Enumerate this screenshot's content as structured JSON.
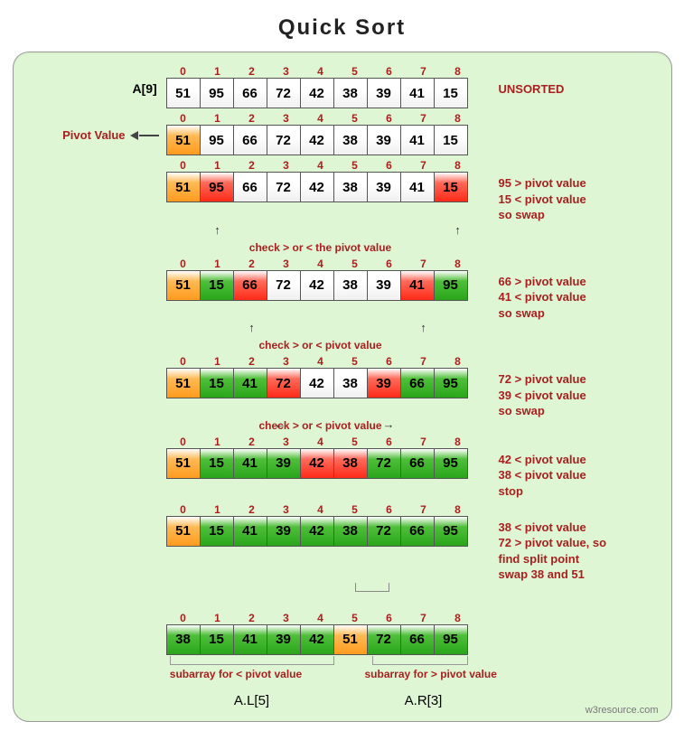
{
  "title": "Quick   Sort",
  "array_label": "A[9]",
  "pivot_label": "Pivot Value",
  "indices": [
    "0",
    "1",
    "2",
    "3",
    "4",
    "5",
    "6",
    "7",
    "8"
  ],
  "stages": [
    {
      "cells": [
        {
          "v": "51",
          "c": "white"
        },
        {
          "v": "95",
          "c": "white"
        },
        {
          "v": "66",
          "c": "white"
        },
        {
          "v": "72",
          "c": "white"
        },
        {
          "v": "42",
          "c": "white"
        },
        {
          "v": "38",
          "c": "white"
        },
        {
          "v": "39",
          "c": "white"
        },
        {
          "v": "41",
          "c": "white"
        },
        {
          "v": "15",
          "c": "white"
        }
      ],
      "right_note": "UNSORTED",
      "show_array_label": true
    },
    {
      "cells": [
        {
          "v": "51",
          "c": "orange"
        },
        {
          "v": "95",
          "c": "white"
        },
        {
          "v": "66",
          "c": "white"
        },
        {
          "v": "72",
          "c": "white"
        },
        {
          "v": "42",
          "c": "white"
        },
        {
          "v": "38",
          "c": "white"
        },
        {
          "v": "39",
          "c": "white"
        },
        {
          "v": "41",
          "c": "white"
        },
        {
          "v": "15",
          "c": "white"
        }
      ],
      "left_note": "pivot"
    },
    {
      "cells": [
        {
          "v": "51",
          "c": "orange"
        },
        {
          "v": "95",
          "c": "red"
        },
        {
          "v": "66",
          "c": "white"
        },
        {
          "v": "72",
          "c": "white"
        },
        {
          "v": "42",
          "c": "white"
        },
        {
          "v": "38",
          "c": "white"
        },
        {
          "v": "39",
          "c": "white"
        },
        {
          "v": "41",
          "c": "white"
        },
        {
          "v": "15",
          "c": "red"
        }
      ],
      "right_note": "95 > pivot value\n15 < pivot value\nso  swap",
      "under_note": "check > or < the pivot value",
      "up_arrows_at": [
        1,
        8
      ]
    },
    {
      "cells": [
        {
          "v": "51",
          "c": "orange"
        },
        {
          "v": "15",
          "c": "green"
        },
        {
          "v": "66",
          "c": "red"
        },
        {
          "v": "72",
          "c": "white"
        },
        {
          "v": "42",
          "c": "white"
        },
        {
          "v": "38",
          "c": "white"
        },
        {
          "v": "39",
          "c": "white"
        },
        {
          "v": "41",
          "c": "red"
        },
        {
          "v": "95",
          "c": "green"
        }
      ],
      "right_note": "66 > pivot value\n41 < pivot value\nso  swap",
      "under_note": "check > or < pivot value",
      "up_arrows_at": [
        2,
        7
      ]
    },
    {
      "cells": [
        {
          "v": "51",
          "c": "orange"
        },
        {
          "v": "15",
          "c": "green"
        },
        {
          "v": "41",
          "c": "green"
        },
        {
          "v": "72",
          "c": "red"
        },
        {
          "v": "42",
          "c": "white"
        },
        {
          "v": "38",
          "c": "white"
        },
        {
          "v": "39",
          "c": "red"
        },
        {
          "v": "66",
          "c": "green"
        },
        {
          "v": "95",
          "c": "green"
        }
      ],
      "right_note": "72 > pivot value\n39 < pivot value\nso  swap",
      "under_note": "check  >  or  <     pivot value",
      "lr_arrows_at": [
        3,
        6
      ]
    },
    {
      "cells": [
        {
          "v": "51",
          "c": "orange"
        },
        {
          "v": "15",
          "c": "green"
        },
        {
          "v": "41",
          "c": "green"
        },
        {
          "v": "39",
          "c": "green"
        },
        {
          "v": "42",
          "c": "red"
        },
        {
          "v": "38",
          "c": "red"
        },
        {
          "v": "72",
          "c": "green"
        },
        {
          "v": "66",
          "c": "green"
        },
        {
          "v": "95",
          "c": "green"
        }
      ],
      "right_note": "42 < pivot value\n38 < pivot value\nstop"
    },
    {
      "cells": [
        {
          "v": "51",
          "c": "orange"
        },
        {
          "v": "15",
          "c": "green"
        },
        {
          "v": "41",
          "c": "green"
        },
        {
          "v": "39",
          "c": "green"
        },
        {
          "v": "42",
          "c": "green"
        },
        {
          "v": "38",
          "c": "green"
        },
        {
          "v": "72",
          "c": "green"
        },
        {
          "v": "66",
          "c": "green"
        },
        {
          "v": "95",
          "c": "green"
        }
      ],
      "right_note": "38 < pivot value\n72 > pivot value, so\nfind split point\nswap 38 and 51",
      "hook": {
        "from": 5,
        "to": 6
      }
    },
    {
      "cells": [
        {
          "v": "38",
          "c": "green"
        },
        {
          "v": "15",
          "c": "green"
        },
        {
          "v": "41",
          "c": "green"
        },
        {
          "v": "39",
          "c": "green"
        },
        {
          "v": "42",
          "c": "green"
        },
        {
          "v": "51",
          "c": "orange"
        },
        {
          "v": "72",
          "c": "green"
        },
        {
          "v": "66",
          "c": "green"
        },
        {
          "v": "95",
          "c": "green"
        }
      ],
      "brackets": true
    }
  ],
  "sub_left_label": "subarray for < pivot value",
  "sub_right_label": "subarray for > pivot value",
  "alr_left": "A.L[5]",
  "alr_right": "A.R[3]",
  "credit": "w3resource.com"
}
